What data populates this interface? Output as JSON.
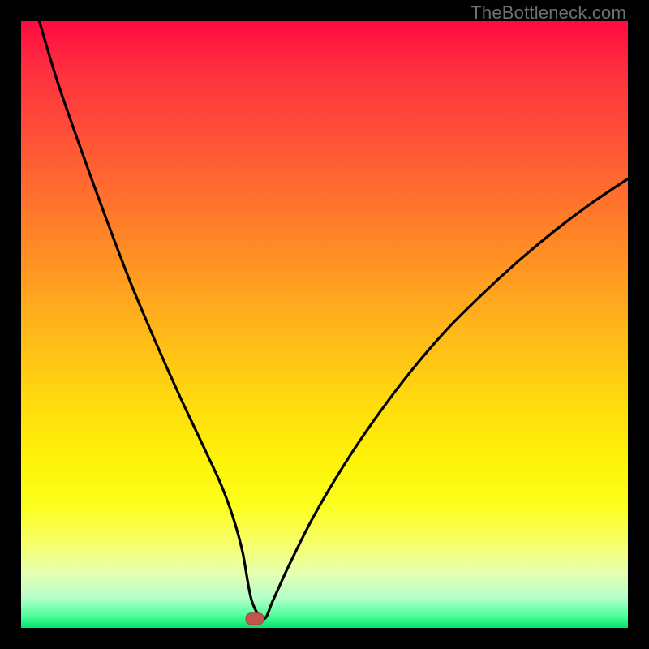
{
  "watermark": "TheBottleneck.com",
  "colors": {
    "frame": "#000000",
    "curve": "#000000",
    "marker_fill": "#c1554e",
    "marker_stroke": "#a64640"
  },
  "chart_data": {
    "type": "line",
    "title": "",
    "xlabel": "",
    "ylabel": "",
    "xlim": [
      0,
      100
    ],
    "ylim": [
      0,
      100
    ],
    "grid": false,
    "legend": false,
    "annotations": [
      {
        "type": "marker",
        "x": 38.5,
        "y": 1.5,
        "shape": "rounded-rect"
      }
    ],
    "series": [
      {
        "name": "bottleneck-curve",
        "x": [
          3,
          6,
          10,
          14,
          18,
          22,
          26,
          30,
          33,
          35,
          36.5,
          38,
          40,
          41.5,
          44,
          48,
          53,
          58,
          64,
          70,
          76,
          82,
          88,
          94,
          100
        ],
        "y": [
          100,
          90,
          78.5,
          67.5,
          57,
          47.5,
          38.5,
          30,
          23.5,
          18,
          12.5,
          4.5,
          1.5,
          4.5,
          10,
          18,
          26.5,
          34,
          42,
          49,
          55,
          60.5,
          65.5,
          70,
          74
        ]
      }
    ]
  }
}
